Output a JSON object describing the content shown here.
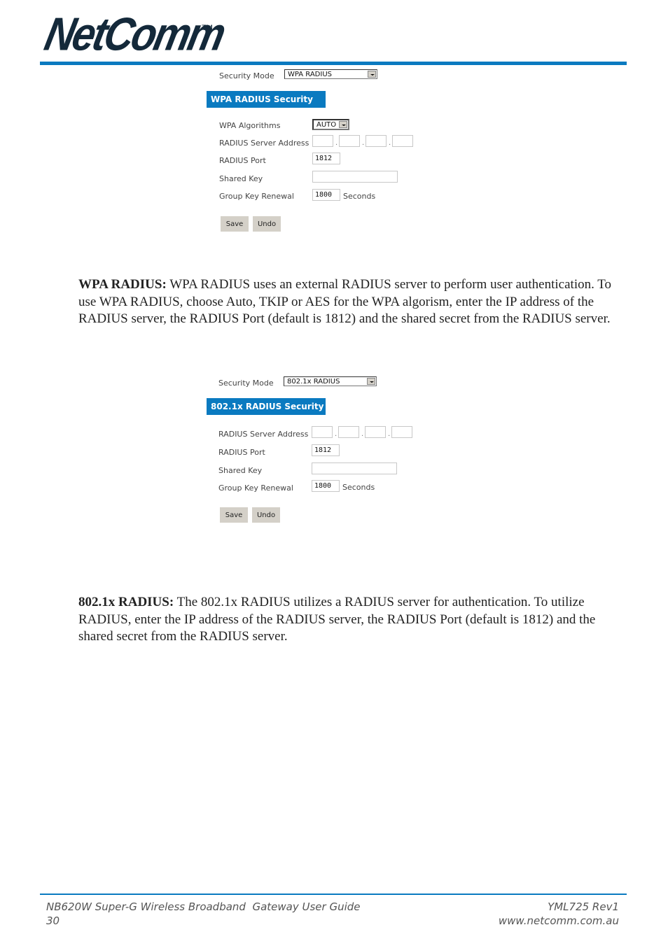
{
  "brand": {
    "logo_text": "NetComm",
    "trademark": "TM",
    "accent_color": "#0a7ac0"
  },
  "wpa_panel": {
    "security_mode_label": "Security Mode",
    "security_mode_value": "WPA RADIUS",
    "section_title": "WPA RADIUS Security",
    "algorithms_label": "WPA Algorithms",
    "algorithms_value": "AUTO",
    "server_address_label": "RADIUS Server Address",
    "server_address_octets": [
      "",
      "",
      "",
      ""
    ],
    "port_label": "RADIUS Port",
    "port_value": "1812",
    "shared_key_label": "Shared Key",
    "shared_key_value": "",
    "renewal_label": "Group Key Renewal",
    "renewal_value": "1800",
    "renewal_unit": "Seconds",
    "save_label": "Save",
    "undo_label": "Undo"
  },
  "wpa_description": {
    "term": "WPA RADIUS:",
    "text": " WPA RADIUS uses an external RADIUS server to perform user authentication. To use WPA RADIUS, choose Auto, TKIP or AES for the WPA algorism, enter the IP address of the RADIUS server, the RADIUS Port (default is 1812) and the shared secret from the RADIUS server."
  },
  "dot1x_panel": {
    "security_mode_label": "Security Mode",
    "security_mode_value": "802.1x RADIUS",
    "section_title": "802.1x RADIUS Security",
    "server_address_label": "RADIUS Server Address",
    "server_address_octets": [
      "",
      "",
      "",
      ""
    ],
    "port_label": "RADIUS Port",
    "port_value": "1812",
    "shared_key_label": "Shared Key",
    "shared_key_value": "",
    "renewal_label": "Group Key Renewal",
    "renewal_value": "1800",
    "renewal_unit": "Seconds",
    "save_label": "Save",
    "undo_label": "Undo"
  },
  "dot1x_description": {
    "term": "802.1x RADIUS:",
    "text": " The 802.1x RADIUS utilizes a RADIUS server for authentication. To utilize RADIUS, enter the IP address of the RADIUS server, the RADIUS Port (default is 1812) and the shared secret from the RADIUS server."
  },
  "footer": {
    "guide_title": "NB620W Super-G Wireless Broadband  Gateway User Guide",
    "page_number": "30",
    "doc_code": "YML725 Rev1",
    "website": "www.netcomm.com.au"
  }
}
